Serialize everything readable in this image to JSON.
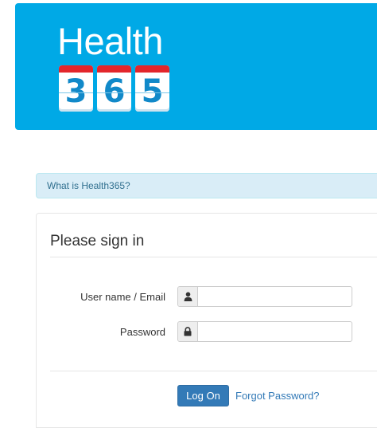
{
  "header": {
    "brand_word": "Health",
    "brand_digits": [
      "3",
      "6",
      "5"
    ],
    "background_color": "#00a9e6",
    "tile_band_color": "#e3262b"
  },
  "info": {
    "link_text": "What is Health365?"
  },
  "login": {
    "title": "Please sign in",
    "username": {
      "label": "User name / Email",
      "value": "",
      "icon": "user-icon"
    },
    "password": {
      "label": "Password",
      "value": "",
      "icon": "lock-icon"
    },
    "logon_label": "Log On",
    "forgot_label": "Forgot Password?"
  }
}
